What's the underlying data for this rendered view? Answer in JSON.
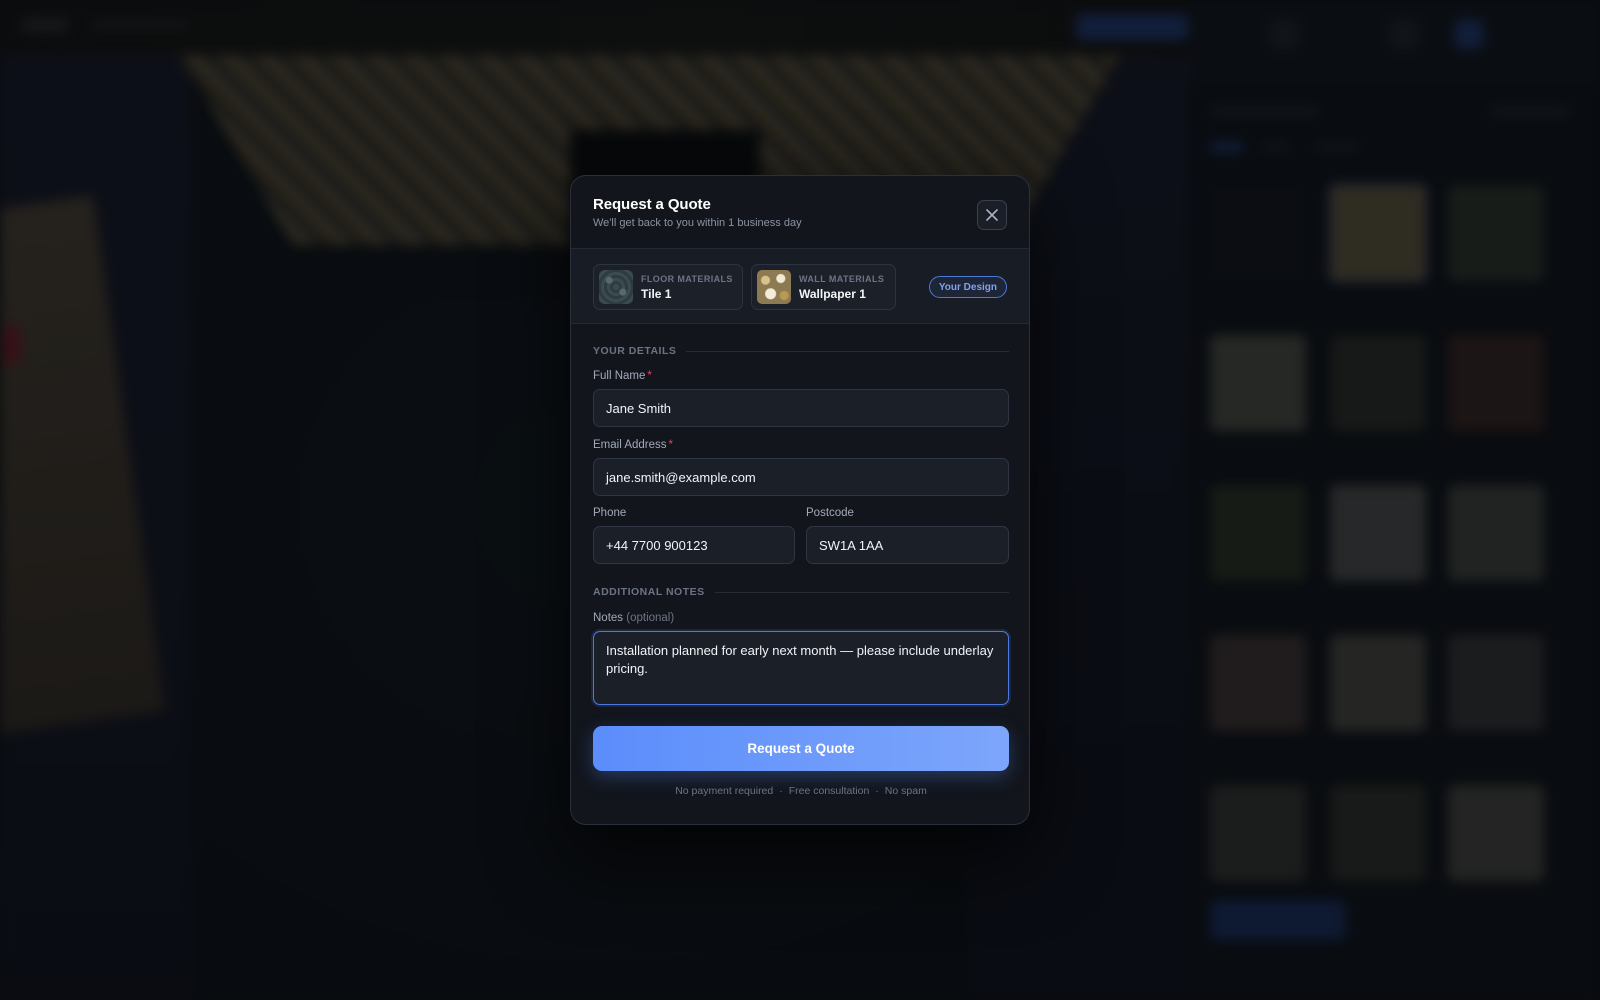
{
  "modal": {
    "title": "Request a Quote",
    "subtitle": "We'll get back to you within 1 business day",
    "close_icon": "close-icon"
  },
  "design": {
    "floor": {
      "category": "FLOOR MATERIALS",
      "name": "Tile 1"
    },
    "wall": {
      "category": "WALL MATERIALS",
      "name": "Wallpaper 1"
    },
    "badge": "Your Design"
  },
  "form": {
    "details_heading": "YOUR DETAILS",
    "full_name": {
      "label": "Full Name",
      "required_mark": "*",
      "value": "Jane Smith"
    },
    "email": {
      "label": "Email Address",
      "required_mark": "*",
      "value": "jane.smith@example.com"
    },
    "phone": {
      "label": "Phone",
      "value": "+44 7700 900123"
    },
    "postcode": {
      "label": "Postcode",
      "value": "SW1A 1AA"
    },
    "notes_heading": "ADDITIONAL NOTES",
    "notes": {
      "label": "Notes",
      "optional_hint": "(optional)",
      "value": "Installation planned for early next month — please include underlay pricing."
    },
    "submit_label": "Request a Quote",
    "assurances": [
      "No payment required",
      "Free consultation",
      "No spam"
    ],
    "separator": "·"
  },
  "colors": {
    "accent": "#5b8dfb",
    "required": "#e0475a",
    "modal_bg": "#12151c"
  }
}
